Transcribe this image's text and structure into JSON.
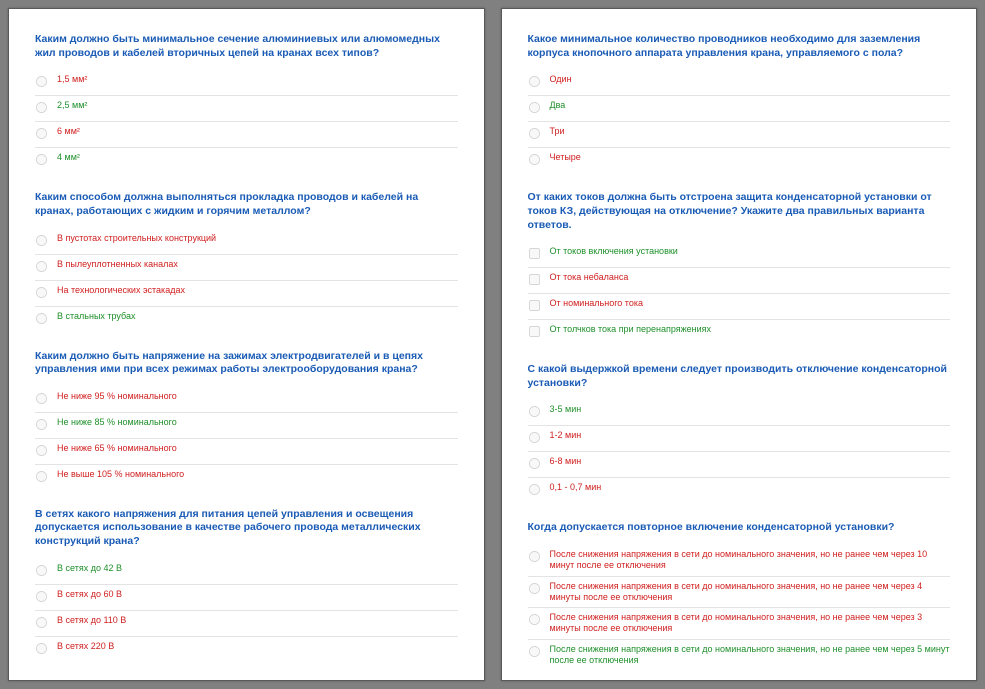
{
  "pages": [
    {
      "questions": [
        {
          "title": "Каким должно быть минимальное сечение алюминиевых или алюмомедных жил проводов и кабелей вторичных цепей на кранах всех типов?",
          "type": "radio",
          "options": [
            {
              "text": "1,5 мм²",
              "color": "red"
            },
            {
              "text": "2,5 мм²",
              "color": "green"
            },
            {
              "text": "6 мм²",
              "color": "red"
            },
            {
              "text": "4 мм²",
              "color": "green"
            }
          ]
        },
        {
          "title": "Каким способом должна выполняться прокладка проводов и кабелей на кранах, работающих с жидким и горячим металлом?",
          "type": "radio",
          "options": [
            {
              "text": "В пустотах строительных конструкций",
              "color": "red"
            },
            {
              "text": "В пылеуплотненных каналах",
              "color": "red"
            },
            {
              "text": "На технологических эстакадах",
              "color": "red"
            },
            {
              "text": "В стальных трубах",
              "color": "green"
            }
          ]
        },
        {
          "title": "Каким должно быть напряжение на зажимах электродвигателей и в цепях управления ими при всех режимах работы электрооборудования крана?",
          "type": "radio",
          "options": [
            {
              "text": "Не ниже 95 % номинального",
              "color": "red"
            },
            {
              "text": "Не ниже 85 % номинального",
              "color": "green"
            },
            {
              "text": "Не ниже 65 % номинального",
              "color": "red"
            },
            {
              "text": "Не выше 105 % номинального",
              "color": "red"
            }
          ]
        },
        {
          "title": "В сетях какого напряжения для питания цепей управления и освещения допускается использование в качестве рабочего провода металлических конструкций крана?",
          "type": "radio",
          "options": [
            {
              "text": "В сетях до 42 В",
              "color": "green"
            },
            {
              "text": "В сетях до 60 В",
              "color": "red"
            },
            {
              "text": "В сетях до 110 В",
              "color": "red"
            },
            {
              "text": "В сетях 220 В",
              "color": "red"
            }
          ]
        }
      ]
    },
    {
      "questions": [
        {
          "title": "Какое минимальное количество проводников необходимо для заземления корпуса кнопочного аппарата управления крана, управляемого с пола?",
          "type": "radio",
          "options": [
            {
              "text": "Один",
              "color": "red"
            },
            {
              "text": "Два",
              "color": "green"
            },
            {
              "text": "Три",
              "color": "red"
            },
            {
              "text": "Четыре",
              "color": "red"
            }
          ]
        },
        {
          "title": "От каких токов должна быть отстроена защита конденсаторной установки от токов КЗ, действующая на отключение? Укажите два правильных варианта ответов.",
          "type": "checkbox",
          "options": [
            {
              "text": "От токов включения установки",
              "color": "green"
            },
            {
              "text": "От тока небаланса",
              "color": "red"
            },
            {
              "text": "От номинального тока",
              "color": "red"
            },
            {
              "text": "От толчков тока при перенапряжениях",
              "color": "green"
            }
          ]
        },
        {
          "title": "С какой выдержкой времени следует производить отключение конденсаторной установки?",
          "type": "radio",
          "options": [
            {
              "text": "3-5 мин",
              "color": "green"
            },
            {
              "text": "1-2 мин",
              "color": "red"
            },
            {
              "text": "6-8 мин",
              "color": "red"
            },
            {
              "text": "0,1 - 0,7 мин",
              "color": "red"
            }
          ]
        },
        {
          "title": "Когда допускается повторное включение конденсаторной установки?",
          "type": "radio",
          "options": [
            {
              "text": "После снижения напряжения в сети до номинального значения, но не ранее чем через 10 минут после ее отключения",
              "color": "red"
            },
            {
              "text": "После снижения напряжения в сети до номинального значения, но не ранее чем через 4 минуты после ее отключения",
              "color": "red"
            },
            {
              "text": "После снижения напряжения в сети до номинального значения, но не ранее чем через 3 минуты после ее отключения",
              "color": "red"
            },
            {
              "text": "После снижения напряжения в сети до номинального значения, но не ранее чем через 5 минут после ее отключения",
              "color": "green"
            }
          ]
        }
      ]
    }
  ]
}
